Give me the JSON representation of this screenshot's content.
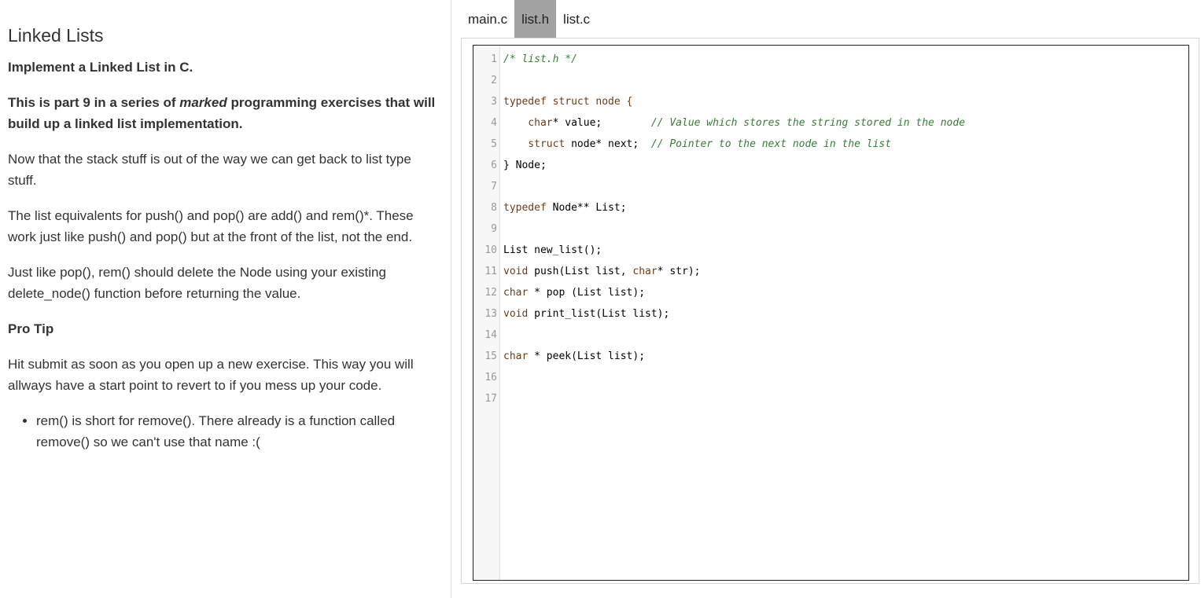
{
  "instructions": {
    "title": "Linked Lists",
    "intro": "Implement a Linked List in C.",
    "series_pre": "This is part 9 in a series of ",
    "series_em": "marked",
    "series_post": " programming exercises that will build up a linked list implementation.",
    "stack_para": "Now that the stack stuff is out of the way we can get back to list type stuff.",
    "equiv_para": "The list equivalents for push() and pop() are add() and rem()*. These work just like push() and pop() but at the front of the list, not the end.",
    "pop_para": "Just like pop(), rem() should delete the Node using your existing delete_node() function before returning the value.",
    "protip_heading": "Pro Tip",
    "protip_para": "Hit submit as soon as you open up a new exercise. This way you will allways have a start point to revert to if you mess up your code.",
    "footnote": "rem() is short for remove(). There already is a function called remove() so we can't use that name :("
  },
  "editor": {
    "tabs": [
      {
        "label": "main.c",
        "active": false
      },
      {
        "label": "list.h",
        "active": true
      },
      {
        "label": "list.c",
        "active": false
      }
    ],
    "lines": [
      {
        "n": "1",
        "tokens": [
          {
            "t": "/* list.h */",
            "c": "comment"
          }
        ]
      },
      {
        "n": "2",
        "tokens": []
      },
      {
        "n": "3",
        "tokens": [
          {
            "t": "typedef struct node {",
            "c": "keyword"
          }
        ]
      },
      {
        "n": "4",
        "tokens": [
          {
            "t": "    char",
            "c": "keyword"
          },
          {
            "t": "* value;        ",
            "c": "plain"
          },
          {
            "t": "// Value which stores the string stored in the node",
            "c": "comment"
          }
        ]
      },
      {
        "n": "5",
        "tokens": [
          {
            "t": "    struct ",
            "c": "keyword"
          },
          {
            "t": "node* next;  ",
            "c": "plain"
          },
          {
            "t": "// Pointer to the next node in the list",
            "c": "comment"
          }
        ]
      },
      {
        "n": "6",
        "tokens": [
          {
            "t": "} Node;",
            "c": "plain"
          }
        ]
      },
      {
        "n": "7",
        "tokens": []
      },
      {
        "n": "8",
        "tokens": [
          {
            "t": "typedef ",
            "c": "keyword"
          },
          {
            "t": "Node** List;",
            "c": "plain"
          }
        ]
      },
      {
        "n": "9",
        "tokens": []
      },
      {
        "n": "10",
        "tokens": [
          {
            "t": "List new_list();",
            "c": "plain"
          }
        ]
      },
      {
        "n": "11",
        "tokens": [
          {
            "t": "void ",
            "c": "keyword"
          },
          {
            "t": "push(List list, ",
            "c": "plain"
          },
          {
            "t": "char",
            "c": "keyword"
          },
          {
            "t": "* str);",
            "c": "plain"
          }
        ]
      },
      {
        "n": "12",
        "tokens": [
          {
            "t": "char ",
            "c": "keyword"
          },
          {
            "t": "* pop (List list);",
            "c": "plain"
          }
        ]
      },
      {
        "n": "13",
        "tokens": [
          {
            "t": "void ",
            "c": "keyword"
          },
          {
            "t": "print_list(List list);",
            "c": "plain"
          }
        ]
      },
      {
        "n": "14",
        "tokens": []
      },
      {
        "n": "15",
        "tokens": [
          {
            "t": "char ",
            "c": "keyword"
          },
          {
            "t": "* peek(List list);",
            "c": "plain"
          }
        ]
      },
      {
        "n": "16",
        "tokens": []
      },
      {
        "n": "17",
        "tokens": []
      }
    ]
  },
  "colors": {
    "active_tab_bg": "#a3a3a3",
    "comment": "#3b7a3b",
    "keyword": "#6b3d1a"
  }
}
